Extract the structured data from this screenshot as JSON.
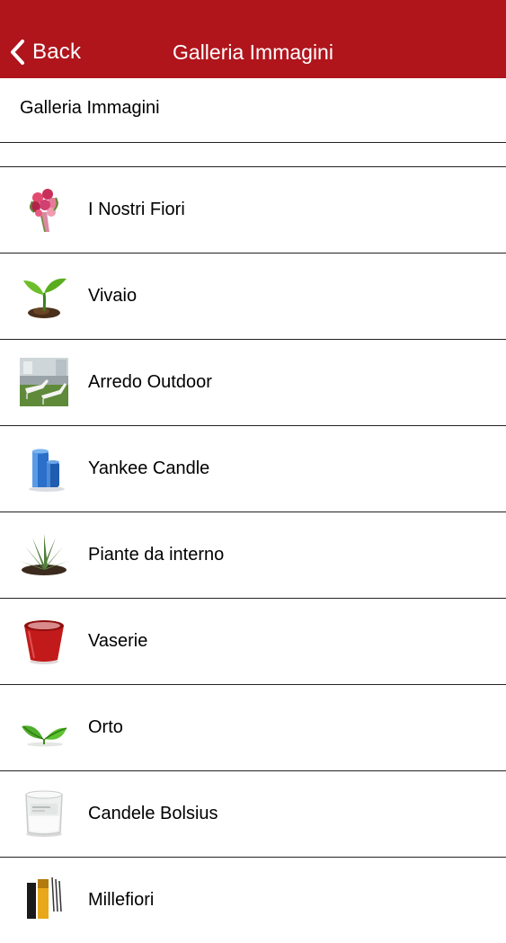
{
  "navbar": {
    "back_label": "Back",
    "title": "Galleria Immagini",
    "background": "#b0151c"
  },
  "page": {
    "title": "Galleria Immagini"
  },
  "items": [
    {
      "label": "I Nostri Fiori",
      "icon": "bouquet-icon"
    },
    {
      "label": "Vivaio",
      "icon": "sprout-icon"
    },
    {
      "label": "Arredo Outdoor",
      "icon": "outdoor-furniture-icon"
    },
    {
      "label": "Yankee Candle",
      "icon": "candle-icon"
    },
    {
      "label": "Piante da interno",
      "icon": "agave-plant-icon"
    },
    {
      "label": "Vaserie",
      "icon": "vase-icon"
    },
    {
      "label": "Orto",
      "icon": "leaves-icon"
    },
    {
      "label": "Candele Bolsius",
      "icon": "glass-candle-icon"
    },
    {
      "label": "Millefiori",
      "icon": "diffuser-icon"
    }
  ]
}
